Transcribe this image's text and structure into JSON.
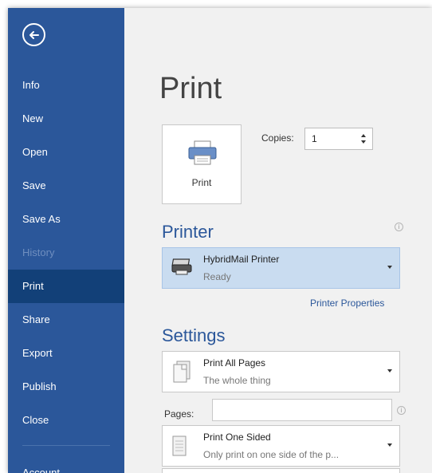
{
  "sidebar": {
    "items": [
      {
        "label": "Info"
      },
      {
        "label": "New"
      },
      {
        "label": "Open"
      },
      {
        "label": "Save"
      },
      {
        "label": "Save As"
      },
      {
        "label": "History"
      },
      {
        "label": "Print"
      },
      {
        "label": "Share"
      },
      {
        "label": "Export"
      },
      {
        "label": "Publish"
      },
      {
        "label": "Close"
      },
      {
        "label": "Account"
      }
    ],
    "active": "Print",
    "back_icon": "arrow-left-circle-icon"
  },
  "main": {
    "title": "Print",
    "print_button": {
      "label": "Print",
      "icon": "printer-icon"
    },
    "copies": {
      "label": "Copies:",
      "value": "1"
    },
    "printer": {
      "heading": "Printer",
      "name": "HybridMail Printer",
      "status": "Ready",
      "properties_link": "Printer Properties",
      "icon": "printer-device-icon"
    },
    "settings": {
      "heading": "Settings",
      "range": {
        "title": "Print All Pages",
        "subtitle": "The whole thing",
        "icon": "pages-icon"
      },
      "pages": {
        "label": "Pages:",
        "value": ""
      },
      "sides": {
        "title": "Print One Sided",
        "subtitle": "Only print on one side of the p...",
        "icon": "single-page-icon"
      }
    }
  },
  "colors": {
    "sidebar_bg": "#2b579a",
    "sidebar_active": "#124078",
    "accent": "#2b579a",
    "content_bg": "#f1f1f1",
    "selected_printer_bg": "#c9dcf0"
  }
}
